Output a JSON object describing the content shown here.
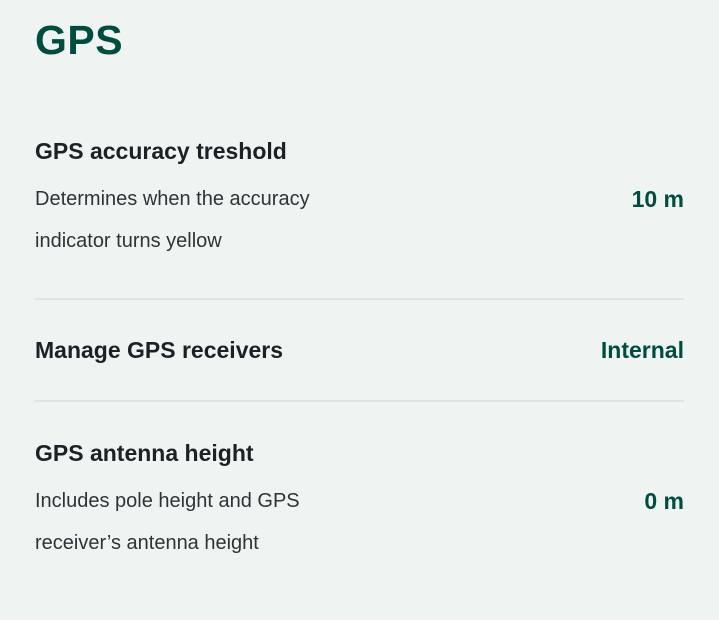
{
  "section": {
    "title": "GPS"
  },
  "settings": [
    {
      "title": "GPS accuracy treshold",
      "description": "Determines when the accuracy indicator turns yellow",
      "value": "10 m"
    },
    {
      "title": "Manage GPS receivers",
      "value": "Internal"
    },
    {
      "title": "GPS antenna height",
      "description": "Includes pole height and GPS receiver’s antenna height",
      "value": "0 m"
    }
  ],
  "colors": {
    "background": "#eff4f2",
    "accent": "#004d40",
    "title_text": "#1c2127",
    "divider": "#dfe3e2"
  }
}
